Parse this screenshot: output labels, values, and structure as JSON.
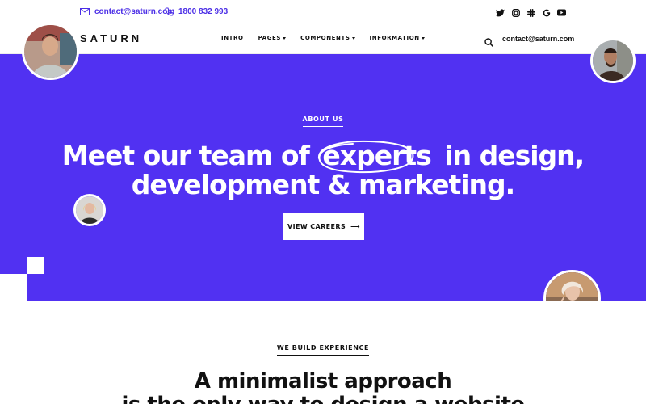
{
  "topbar": {
    "email": "contact@saturn.com",
    "phone": "1800 832 993",
    "socials": [
      "twitter-icon",
      "instagram-icon",
      "slack-icon",
      "google-icon",
      "youtube-icon"
    ]
  },
  "nav": {
    "logo": "SATURN",
    "items": [
      {
        "label": "INTRO"
      },
      {
        "label": "PAGES"
      },
      {
        "label": "COMPONENTS"
      },
      {
        "label": "INFORMATION"
      }
    ],
    "email": "contact@saturn.com"
  },
  "hero": {
    "eyebrow": "ABOUT US",
    "headline_line1_a": "Meet our team of",
    "headline_highlight": "experts",
    "headline_line1_b": "in design,",
    "headline_line2": "development & marketing.",
    "button_label": "VIEW CAREERS",
    "button_arrow": "⟶"
  },
  "section2": {
    "eyebrow": "WE BUILD EXPERIENCE",
    "headline_line1": "A minimalist approach",
    "headline_line2": "is the only way to design a website"
  },
  "colors": {
    "accent": "#5131f2",
    "contact_text": "#4b2ee6"
  }
}
